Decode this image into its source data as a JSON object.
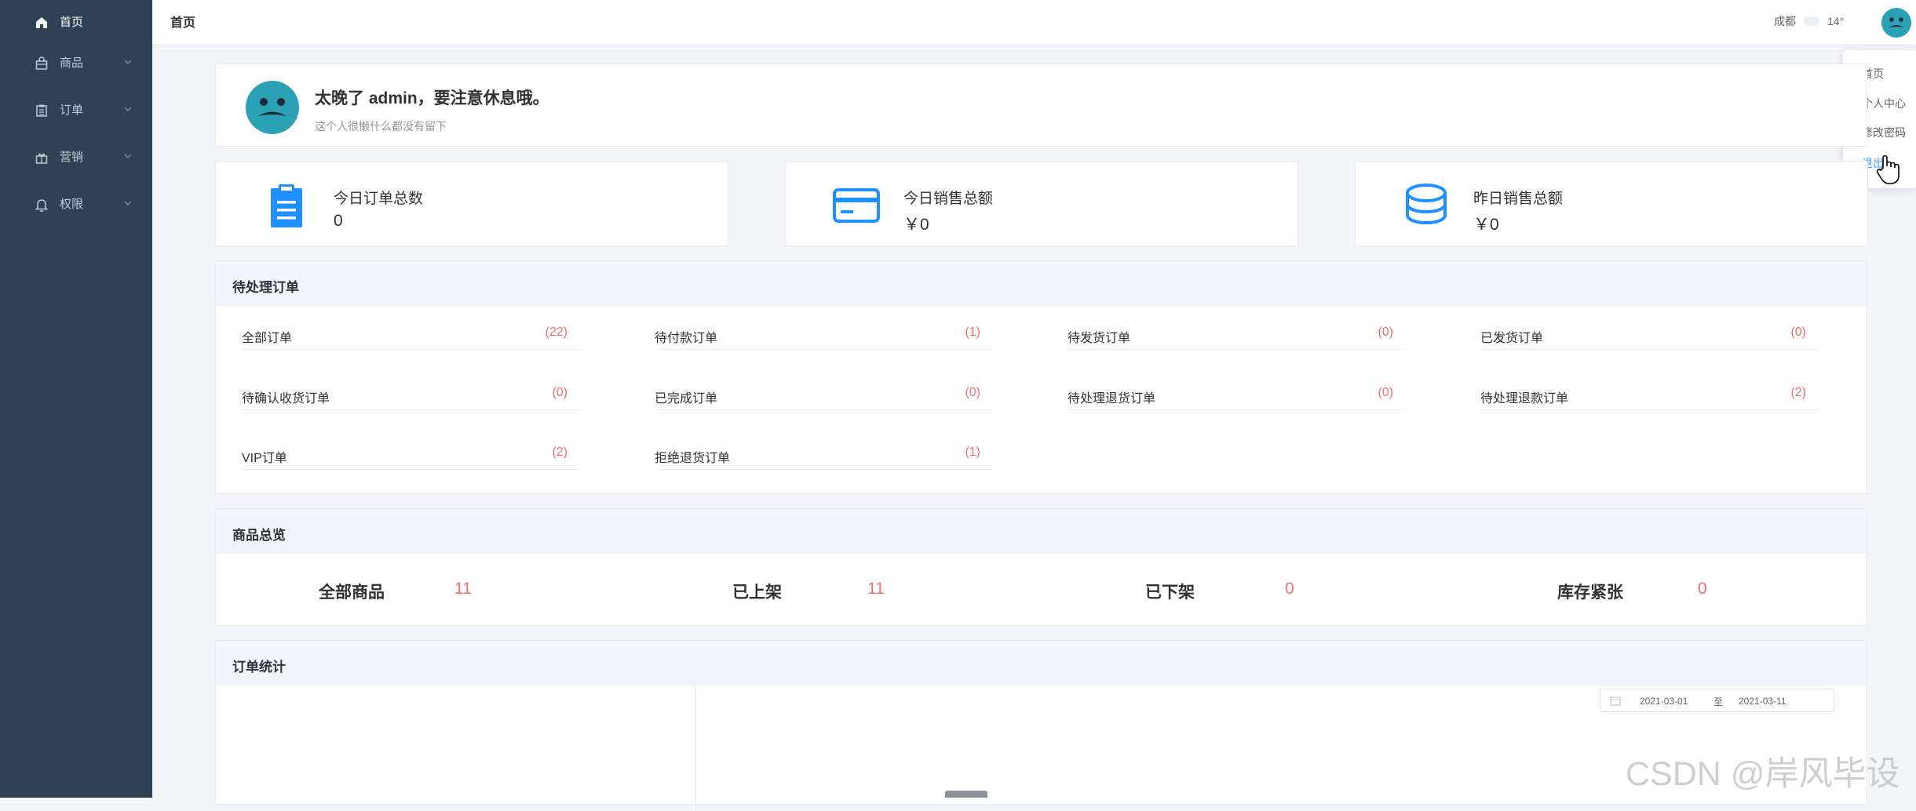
{
  "sidebar": {
    "items": [
      {
        "label": "首页",
        "icon": "home-icon"
      },
      {
        "label": "商品",
        "icon": "shopping-bag-icon"
      },
      {
        "label": "订单",
        "icon": "clipboard-icon"
      },
      {
        "label": "营销",
        "icon": "gift-icon"
      },
      {
        "label": "权限",
        "icon": "bell-icon"
      }
    ]
  },
  "header": {
    "breadcrumb": "首页",
    "city": "成都",
    "temperature": "14°"
  },
  "user_menu": {
    "items": [
      "首页",
      "个人中心",
      "修改密码",
      "退出"
    ]
  },
  "welcome": {
    "greeting": "太晚了 admin，要注意休息哦。",
    "motto": "这个人很懒什么都没有留下"
  },
  "stats": [
    {
      "title": "今日订单总数",
      "value": "0",
      "icon": "clipboard-icon"
    },
    {
      "title": "今日销售总额",
      "value": "￥0",
      "icon": "credit-card-icon"
    },
    {
      "title": "昨日销售总额",
      "value": "￥0",
      "icon": "coins-stack-icon"
    }
  ],
  "pending_orders": {
    "title": "待处理订单",
    "items": [
      {
        "label": "全部订单",
        "count": "(22)"
      },
      {
        "label": "待付款订单",
        "count": "(1)"
      },
      {
        "label": "待发货订单",
        "count": "(0)"
      },
      {
        "label": "已发货订单",
        "count": "(0)"
      },
      {
        "label": "待确认收货订单",
        "count": "(0)"
      },
      {
        "label": "已完成订单",
        "count": "(0)"
      },
      {
        "label": "待处理退货订单",
        "count": "(0)"
      },
      {
        "label": "待处理退款订单",
        "count": "(2)"
      },
      {
        "label": "VIP订单",
        "count": "(2)"
      },
      {
        "label": "拒绝退货订单",
        "count": "(1)"
      }
    ]
  },
  "goods_overview": {
    "title": "商品总览",
    "items": [
      {
        "label": "全部商品",
        "value": "11"
      },
      {
        "label": "已上架",
        "value": "11"
      },
      {
        "label": "已下架",
        "value": "0"
      },
      {
        "label": "库存紧张",
        "value": "0"
      }
    ]
  },
  "order_stats": {
    "title": "订单统计",
    "date_start": "2021-03-01",
    "date_separator": "至",
    "date_end": "2021-03-11"
  },
  "watermark": "CSDN @岸风毕设",
  "colors": {
    "sidebar_bg": "#304156",
    "accent_blue": "#409eff",
    "count_red": "#f56c6c",
    "avatar_teal": "#2ba1b5"
  }
}
